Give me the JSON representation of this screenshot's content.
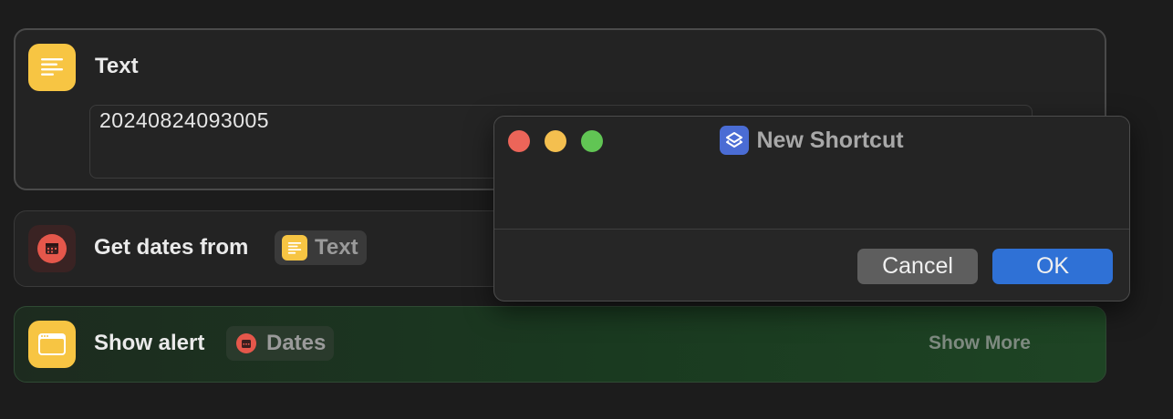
{
  "actions": {
    "text": {
      "title": "Text",
      "value": "20240824093005",
      "icon": "text-lines-icon"
    },
    "get_dates": {
      "title": "Get dates from",
      "icon": "calendar-icon",
      "token_label": "Text",
      "token_icon": "text-lines-icon"
    },
    "show_alert": {
      "title": "Show alert",
      "icon": "window-icon",
      "token_label": "Dates",
      "token_icon": "calendar-icon",
      "show_more": "Show More"
    }
  },
  "dialog": {
    "title": "New Shortcut",
    "icon": "shortcuts-icon",
    "cancel_label": "Cancel",
    "ok_label": "OK"
  },
  "colors": {
    "yellow": "#f7c543",
    "red": "#e5574b",
    "blue_button": "#2f71d6",
    "close": "#ec6559",
    "minimize": "#f4bf4f",
    "zoom": "#61c554"
  }
}
